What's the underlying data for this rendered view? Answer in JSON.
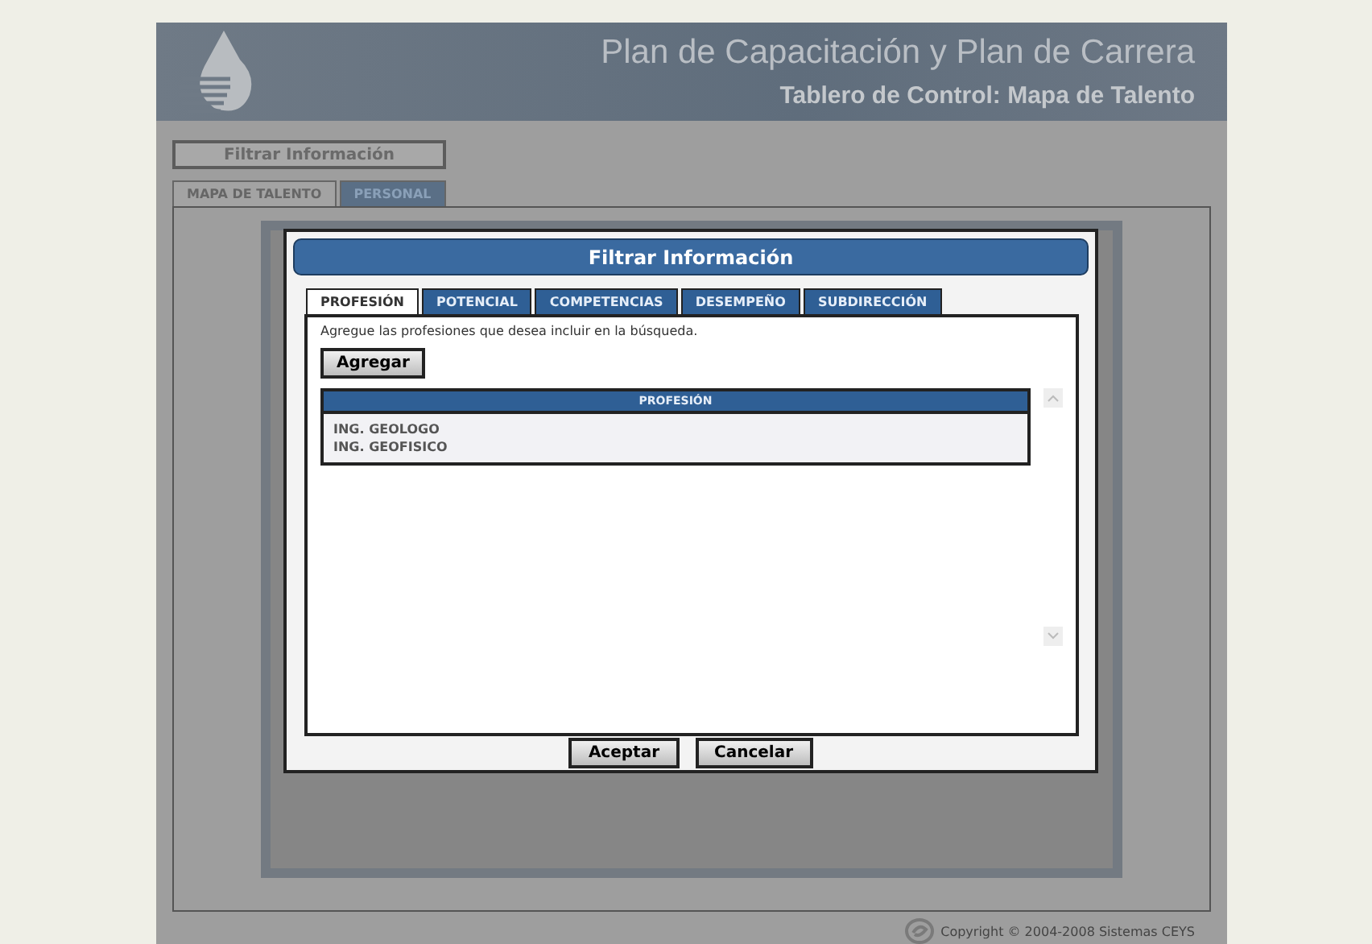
{
  "header": {
    "title": "Plan de Capacitación y Plan de Carrera",
    "subtitle": "Tablero de Control: Mapa de Talento"
  },
  "filter_button": "Filtrar Información",
  "tabs": [
    {
      "label": "MAPA DE TALENTO",
      "selected": true
    },
    {
      "label": "PERSONAL",
      "selected": false
    }
  ],
  "footer": {
    "copyright": "Copyright © 2004-2008 Sistemas CEYS"
  },
  "dialog": {
    "title": "Filtrar Información",
    "tabs": [
      {
        "label": "PROFESIÓN",
        "selected": true
      },
      {
        "label": "POTENCIAL",
        "selected": false
      },
      {
        "label": "COMPETENCIAS",
        "selected": false
      },
      {
        "label": "DESEMPEÑO",
        "selected": false
      },
      {
        "label": "SUBDIRECCIÓN",
        "selected": false
      }
    ],
    "instruction": "Agregue las profesiones que desea incluir en la búsqueda.",
    "add_button": "Agregar",
    "table": {
      "columns": [
        "PROFESIÓN"
      ],
      "rows": [
        "ING. GEOLOGO",
        "ING. GEOFISICO"
      ]
    },
    "buttons": [
      "Aceptar",
      "Cancelar"
    ]
  }
}
